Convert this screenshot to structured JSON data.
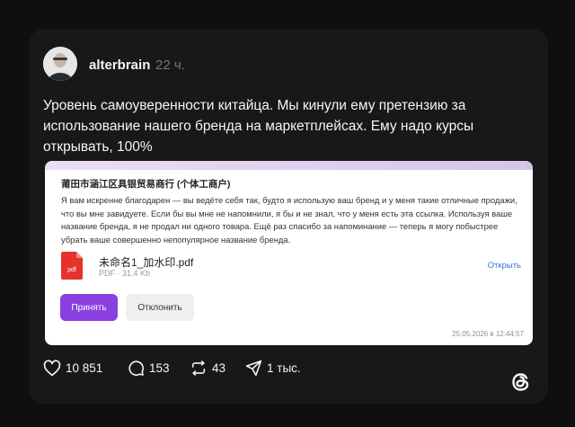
{
  "post": {
    "username": "alterbrain",
    "time": "22 ч.",
    "text": "Уровень самоуверенности китайца. Мы кинули ему претензию за использование нашего бренда на маркетплейсах. Ему надо курсы открывать, 100%"
  },
  "attachment": {
    "sender": "莆田市涵江区具银贸易商行 (个体工商户)",
    "message": "Я вам искренне благодарен — вы ведёте себя так, будто я использую ваш бренд и у меня такие отличные продажи, что вы мне завидуете. Если бы вы мне не напомнили, я бы и не знал, что у меня есть эта ссылка. Используя ваше название бренда, я не продал ни одного товара. Ещё раз спасибо за напоминание — теперь я могу побыстрее убрать ваше совершенно непопулярное название бренда.",
    "file": {
      "name": "未命名1_加水印.pdf",
      "meta": "PDF · 31.4 Kb",
      "icon_label": "pdf",
      "open_label": "Открыть"
    },
    "accept_label": "Принять",
    "decline_label": "Отклонить",
    "timestamp": "25.05.2026 в 12:44:57"
  },
  "actions": {
    "likes": "10 851",
    "comments": "153",
    "reposts": "43",
    "shares": "1 тыс."
  },
  "icons": {
    "like": "heart-icon",
    "comment": "comment-icon",
    "repost": "repost-icon",
    "share": "share-icon",
    "brand": "threads-logo-icon",
    "file": "pdf-file-icon"
  },
  "colors": {
    "background": "#0f0f0f",
    "card": "#181818",
    "accent_purple": "#8a3fe0",
    "link_blue": "#3b6fd8",
    "pdf_red": "#e5322d"
  }
}
